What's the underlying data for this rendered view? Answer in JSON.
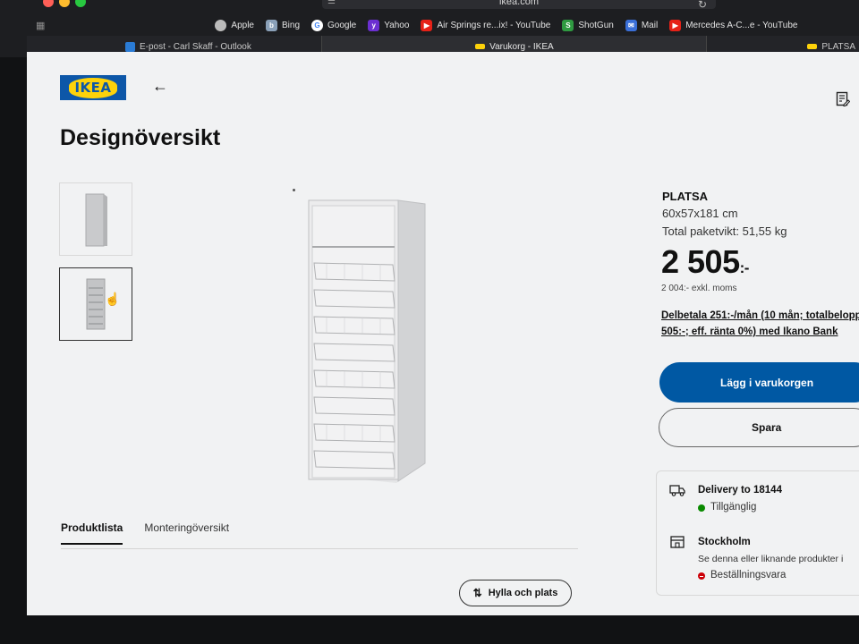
{
  "browser": {
    "url": "ikea.com",
    "bookmarks": [
      {
        "label": "Apple",
        "icon": "apple-icon",
        "color": "#bbbbbb"
      },
      {
        "label": "Bing",
        "icon": "bing-icon",
        "color": "#8aa0b8"
      },
      {
        "label": "Google",
        "icon": "google-icon",
        "color": "#ffffff"
      },
      {
        "label": "Yahoo",
        "icon": "yahoo-icon",
        "color": "#6b2fd1"
      },
      {
        "label": "Air Springs re...ix! - YouTube",
        "icon": "youtube-icon",
        "color": "#e62117"
      },
      {
        "label": "ShotGun",
        "icon": "shotgun-icon",
        "color": "#2f9a41"
      },
      {
        "label": "Mail",
        "icon": "mail-icon",
        "color": "#3a6fd8"
      },
      {
        "label": "Mercedes A-C...e - YouTube",
        "icon": "youtube-icon",
        "color": "#e62117"
      }
    ],
    "tabs": [
      {
        "label": "E-post - Carl Skaff - Outlook",
        "icon": "outlook-icon"
      },
      {
        "label": "Varukorg - IKEA",
        "icon": "ikea-icon"
      },
      {
        "label": "PLATSA",
        "icon": "ikea-icon"
      }
    ]
  },
  "page": {
    "logo": "IKEA",
    "title": "Designöversikt",
    "product": {
      "name": "PLATSA",
      "dimensions": "60x57x181 cm",
      "weight": "Total paketvikt: 51,55 kg",
      "price": "2 505",
      "price_suffix": ":-",
      "price_ex_vat": "2 004:- exkl. moms",
      "finance_line1": "Delbetala 251:-/mån (10 mån; totalbelopp",
      "finance_line2": "505:-; eff. ränta 0%) med Ikano Bank"
    },
    "buttons": {
      "add_to_cart": "Lägg i varukorgen",
      "save": "Spara",
      "shelf": "Hylla och plats"
    },
    "tabs": [
      "Produktlista",
      "Monteringöversikt"
    ],
    "availability": {
      "delivery": "Delivery to 18144",
      "delivery_status": "Tillgänglig",
      "store": "Stockholm",
      "store_desc": "Se denna eller liknande produkter i",
      "store_status": "Beställningsvara"
    },
    "colors": {
      "ikea_blue": "#0058a3",
      "ikea_yellow": "#fdd20a",
      "available": "#0a8a00",
      "order_item": "#cc0008"
    }
  }
}
